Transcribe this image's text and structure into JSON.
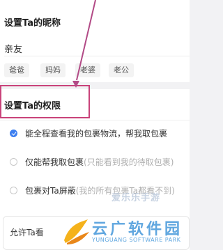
{
  "nickname_section": {
    "title": "设置Ta的昵称",
    "value": "亲友",
    "chips": [
      "爸爸",
      "妈妈",
      "老婆",
      "老公"
    ]
  },
  "permission_section": {
    "title": "设置Ta的权限",
    "options": [
      {
        "label": "能全程查看我的包裹物流，帮我取包裹",
        "note": "",
        "selected": true
      },
      {
        "label": "仅能帮我取包裹",
        "note": "(只能看到我的待取包裹)",
        "selected": false
      },
      {
        "label": "包裹对Ta屏蔽",
        "note": "(我的所有包裹Ta都看不到)",
        "selected": false
      }
    ]
  },
  "bottom_card": {
    "text": "允许Ta看"
  },
  "watermark": {
    "top_text": "爱乐乐手游",
    "brand": "云广软件园",
    "sub": "YUNGUANG SOFTWARE PARK"
  },
  "colors": {
    "accent": "#3d7ff0",
    "highlight_box": "#c9437a",
    "arrow": "#b24a86"
  },
  "icons": {
    "arrow": "annotation-arrow-icon",
    "checked": "radio-checked-icon",
    "unchecked": "radio-unchecked-icon",
    "logo": "yunguang-logo-icon"
  }
}
